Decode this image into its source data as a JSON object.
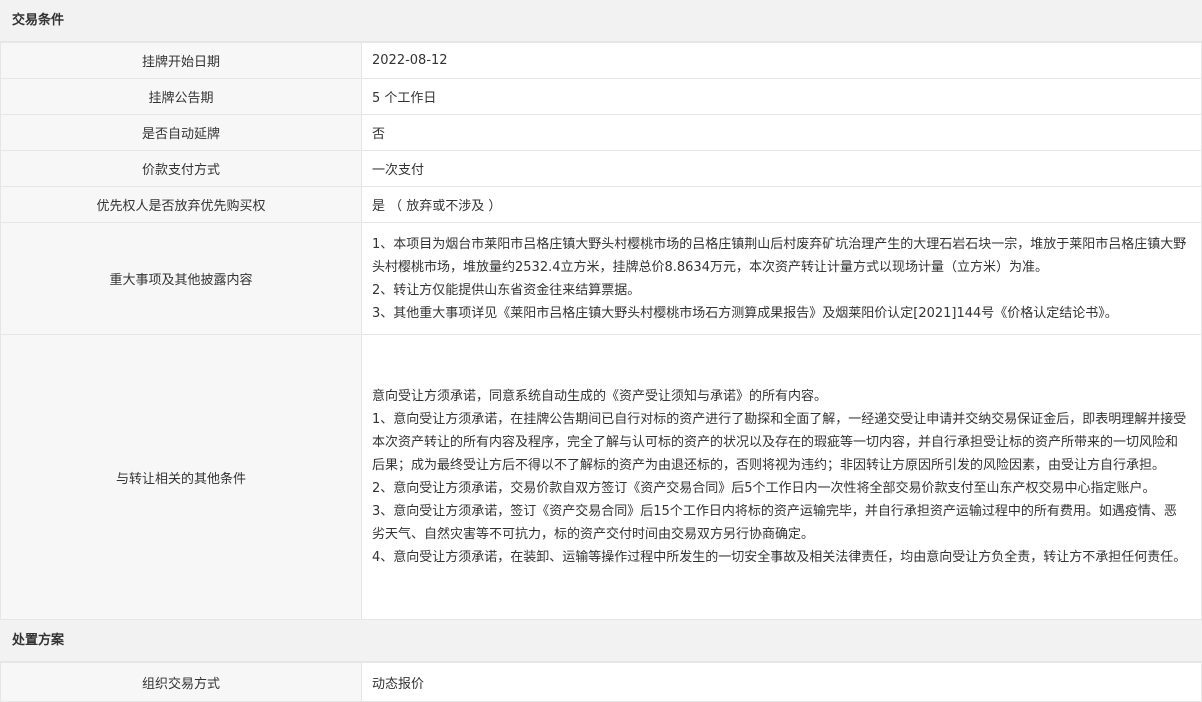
{
  "sections": {
    "trade_conditions": {
      "title": "交易条件",
      "rows": [
        {
          "label": "挂牌开始日期",
          "value": "2022-08-12"
        },
        {
          "label": "挂牌公告期",
          "value": "5 个工作日"
        },
        {
          "label": "是否自动延牌",
          "value": "否"
        },
        {
          "label": "价款支付方式",
          "value": "一次支付"
        },
        {
          "label": "优先权人是否放弃优先购买权",
          "value": "是 （ 放弃或不涉及 ）"
        }
      ],
      "major_matters": {
        "label": "重大事项及其他披露内容",
        "lines": [
          "1、本项目为烟台市莱阳市吕格庄镇大野头村樱桃市场的吕格庄镇荆山后村废弃矿坑治理产生的大理石岩石块一宗，堆放于莱阳市吕格庄镇大野头村樱桃市场，堆放量约2532.4立方米，挂牌总价8.8634万元，本次资产转让计量方式以现场计量（立方米）为准。",
          "2、转让方仅能提供山东省资金往来结算票据。",
          "3、其他重大事项详见《莱阳市吕格庄镇大野头村樱桃市场石方测算成果报告》及烟莱阳价认定[2021]144号《价格认定结论书》。"
        ]
      },
      "other_conditions": {
        "label": "与转让相关的其他条件",
        "lines": [
          "意向受让方须承诺，同意系统自动生成的《资产受让须知与承诺》的所有内容。",
          "1、意向受让方须承诺，在挂牌公告期间已自行对标的资产进行了勘探和全面了解，一经递交受让申请并交纳交易保证金后，即表明理解并接受本次资产转让的所有内容及程序，完全了解与认可标的资产的状况以及存在的瑕疵等一切内容，并自行承担受让标的资产所带来的一切风险和后果；成为最终受让方后不得以不了解标的资产为由退还标的，否则将视为违约；非因转让方原因所引发的风险因素，由受让方自行承担。",
          "2、意向受让方须承诺，交易价款自双方签订《资产交易合同》后5个工作日内一次性将全部交易价款支付至山东产权交易中心指定账户。",
          "3、意向受让方须承诺，签订《资产交易合同》后15个工作日内将标的资产运输完毕，并自行承担资产运输过程中的所有费用。如遇疫情、恶劣天气、自然灾害等不可抗力，标的资产交付时间由交易双方另行协商确定。",
          "4、意向受让方须承诺，在装卸、运输等操作过程中所发生的一切安全事故及相关法律责任，均由意向受让方负全责，转让方不承担任何责任。"
        ]
      }
    },
    "disposal_plan": {
      "title": "处置方案",
      "rows": [
        {
          "label": "组织交易方式",
          "value": "动态报价"
        }
      ]
    }
  }
}
